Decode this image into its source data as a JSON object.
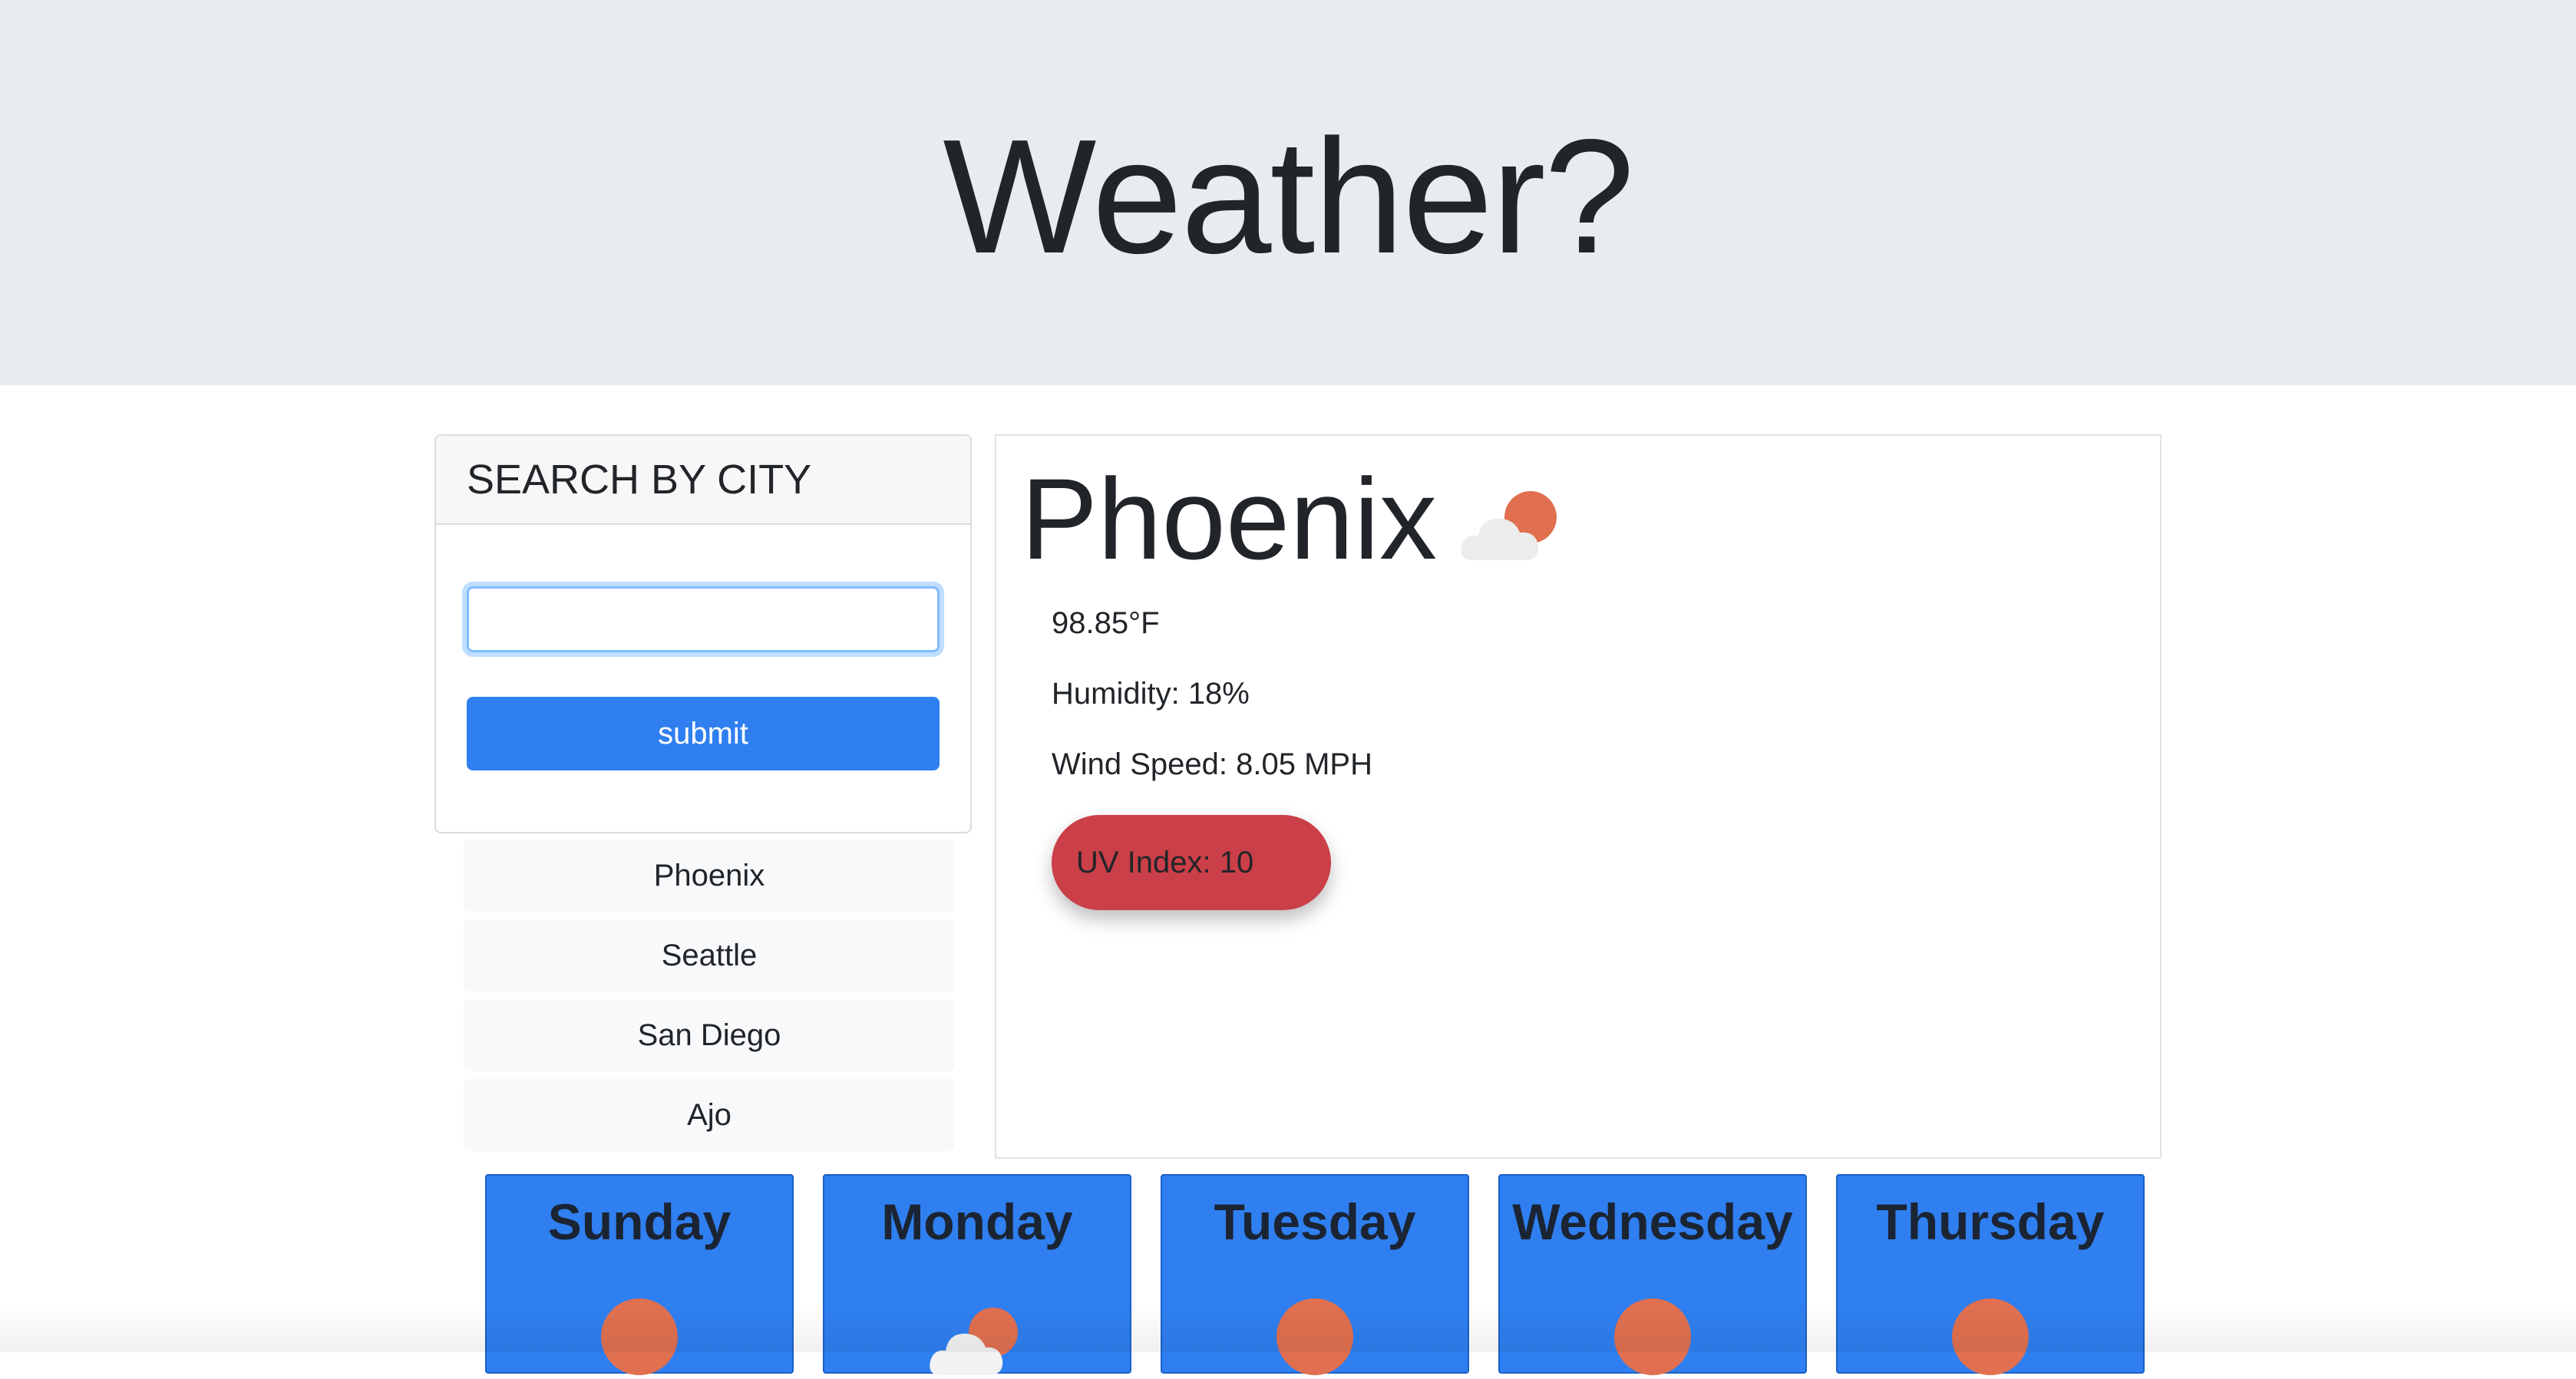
{
  "header": {
    "title": "Weather?"
  },
  "search": {
    "title": "SEARCH BY CITY",
    "input_value": "",
    "submit_label": "submit"
  },
  "history": [
    {
      "label": "Phoenix"
    },
    {
      "label": "Seattle"
    },
    {
      "label": "San Diego"
    },
    {
      "label": "Ajo"
    }
  ],
  "current": {
    "city": "Phoenix",
    "icon": "partly-cloudy-icon",
    "temperature": "98.85°F",
    "humidity": "Humidity: 18%",
    "wind": "Wind Speed: 8.05 MPH",
    "uv": "UV Index: 10",
    "uv_color": "#cb3f48"
  },
  "forecast": [
    {
      "day": "Sunday",
      "icon": "sun-icon"
    },
    {
      "day": "Monday",
      "icon": "partly-cloudy-icon"
    },
    {
      "day": "Tuesday",
      "icon": "sun-icon"
    },
    {
      "day": "Wednesday",
      "icon": "sun-icon"
    },
    {
      "day": "Thursday",
      "icon": "sun-icon"
    }
  ],
  "colors": {
    "accent": "#2f7ff0",
    "jumbotron": "#e9ecef",
    "sun": "#e07050"
  }
}
